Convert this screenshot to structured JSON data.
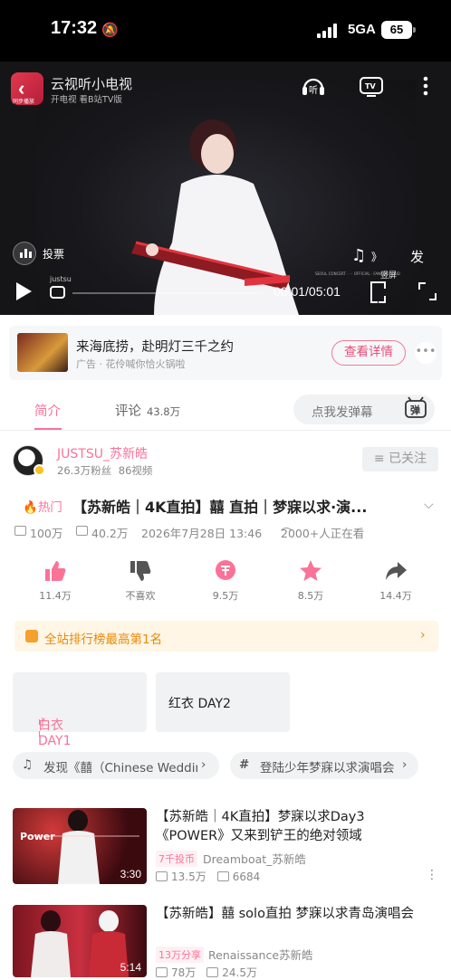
{
  "status_bar": {
    "time": "17:32",
    "network": "5GA",
    "battery": "65"
  },
  "player": {
    "brand_title": "云视听小电视",
    "brand_subtitle": "开电视 看B站TV版",
    "logo_badge": "同步播放",
    "vote_label": "投票",
    "send_label": "发",
    "vertical_label": "竖屏",
    "time": "00:01/05:01",
    "watermark": "justsu"
  },
  "ad": {
    "title": "来海底捞，赴明灯三千之约",
    "subtitle": "广告 · 花伶喊你恰火锅啦",
    "button": "查看详情"
  },
  "tabs": {
    "intro": "简介",
    "comments": "评论",
    "comments_count": "43.8万",
    "danmaku_placeholder": "点我发弹幕",
    "danmaku_icon_label": "弹"
  },
  "uploader": {
    "name": "JUSTSU_苏新皓",
    "fans": "26.3万粉丝",
    "videos": "86视频",
    "follow_label": "已关注"
  },
  "video": {
    "hot_label": "热门",
    "title": "【苏新皓｜4K直拍】囍 直拍｜梦寐以求·演...",
    "views": "100万",
    "danmaku": "40.2万",
    "date": "2026年7月28日 13:46",
    "watching": "2000+人正在看"
  },
  "actions": [
    {
      "label": "11.4万",
      "icon": "thumb-up-icon"
    },
    {
      "label": "不喜欢",
      "icon": "thumb-down-icon"
    },
    {
      "label": "9.5万",
      "icon": "coin-icon"
    },
    {
      "label": "8.5万",
      "icon": "star-icon"
    },
    {
      "label": "14.4万",
      "icon": "share-icon"
    }
  ],
  "ranking": {
    "text": "全站排行榜最高第1名"
  },
  "parts": [
    {
      "label": "白衣 DAY1",
      "selected": true
    },
    {
      "label": "红衣 DAY2",
      "selected": false
    }
  ],
  "pills": [
    {
      "label": "发现《囍（Chinese Wedding"
    },
    {
      "label": "登陆少年梦寐以求演唱会"
    }
  ],
  "recommendations": [
    {
      "title": "【苏新皓｜4K直拍】梦寐以求Day3《POWER》又来到铲王的绝对领域",
      "tag": "7千投币",
      "author": "Dreamboat_苏新皓",
      "views": "13.5万",
      "danmaku": "6684",
      "duration": "3:30",
      "thumb_text": "Power"
    },
    {
      "title": "【苏新皓】囍 solo直拍 梦寐以求青岛演唱会",
      "tag": "13万分享",
      "author": "Renaissance苏新皓",
      "views": "78万",
      "danmaku": "24.5万",
      "duration": "5:14"
    }
  ],
  "colors": {
    "accent": "#fb7299",
    "ranking": "#e88a0a"
  }
}
